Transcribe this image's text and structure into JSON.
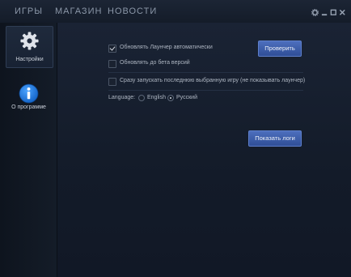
{
  "nav": {
    "items": [
      {
        "label": "ИГРЫ"
      },
      {
        "label": "МАГАЗИН"
      },
      {
        "label": "НОВОСТИ"
      }
    ]
  },
  "sidebar": {
    "items": [
      {
        "label": "Настройки",
        "icon": "gear-icon",
        "active": true
      },
      {
        "label": "О программе",
        "icon": "info-icon",
        "active": false
      }
    ]
  },
  "settings": {
    "auto_update_label": "Обновлять Лаунчер автоматически",
    "auto_update_checked": true,
    "beta_label": "Обновлять до бета версий",
    "beta_checked": false,
    "launch_last_label": "Сразу запускать последнюю выбранную игру (не показывать лаунчер)",
    "launch_last_checked": false,
    "language_label": "Language:",
    "languages": [
      "English",
      "Русский"
    ],
    "selected_language": "Русский",
    "check_button": "Проверить",
    "logs_button": "Показать логи"
  },
  "colors": {
    "accent": "#3d5fae",
    "background": "#121a26"
  }
}
